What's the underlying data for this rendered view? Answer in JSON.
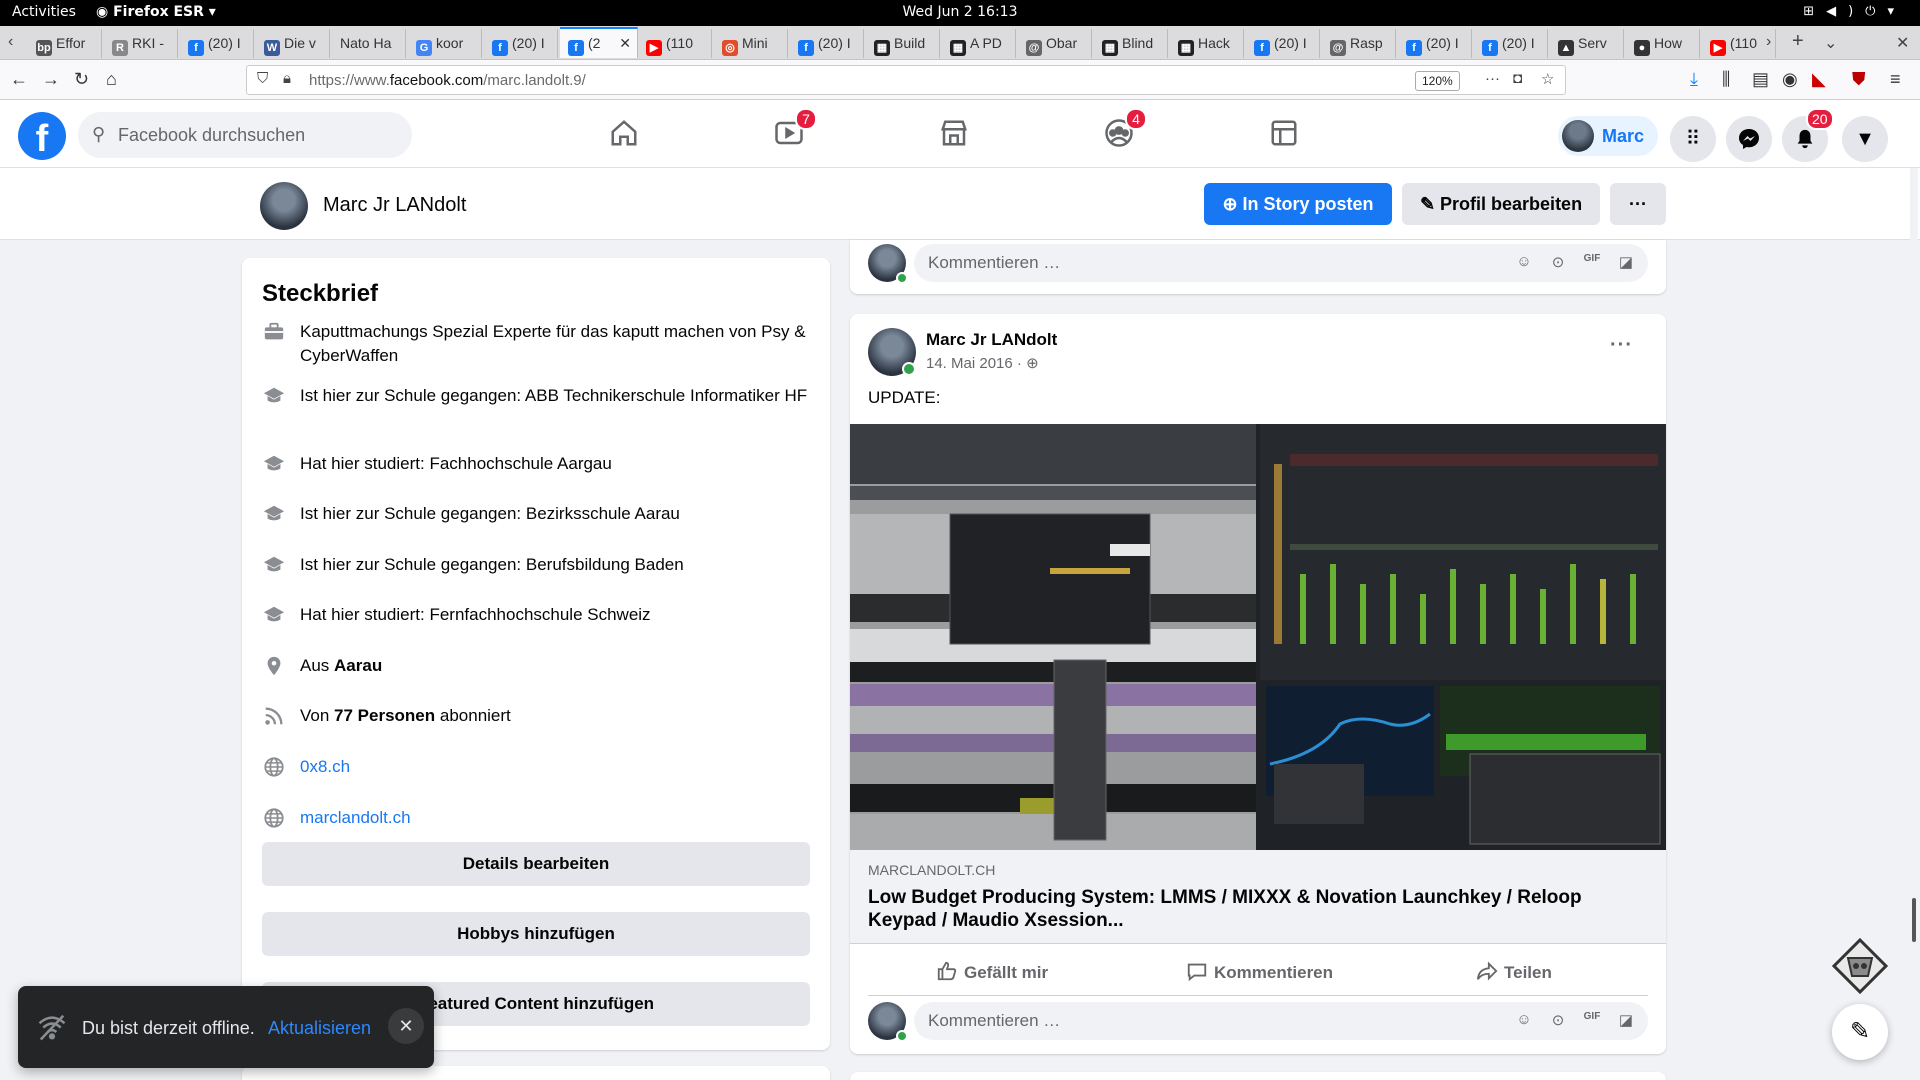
{
  "system": {
    "activities": "Activities",
    "app_name": "Firefox ESR",
    "clock": "Wed Jun 2  16:13"
  },
  "tabs": [
    {
      "label": "Effor",
      "fav": "bp",
      "color": "#555555"
    },
    {
      "label": "RKI -",
      "fav": "R",
      "color": "#888888"
    },
    {
      "label": "(20) I",
      "fav": "f",
      "color": "#1877f2"
    },
    {
      "label": "Die v",
      "fav": "W",
      "color": "#3b5b99"
    },
    {
      "label": "Nato Ha",
      "fav": "",
      "color": "#dcdcdf"
    },
    {
      "label": "koor",
      "fav": "G",
      "color": "#4285f4"
    },
    {
      "label": "(20) I",
      "fav": "f",
      "color": "#1877f2"
    },
    {
      "label": "(2",
      "fav": "f",
      "color": "#1877f2",
      "active": true
    },
    {
      "label": "(110",
      "fav": "▶",
      "color": "#ff0000"
    },
    {
      "label": "Mini",
      "fav": "◎",
      "color": "#e24c2c"
    },
    {
      "label": "(20) I",
      "fav": "f",
      "color": "#1877f2"
    },
    {
      "label": "Build",
      "fav": "▦",
      "color": "#222222"
    },
    {
      "label": "A PD",
      "fav": "▦",
      "color": "#222222"
    },
    {
      "label": "Obar",
      "fav": "@",
      "color": "#666666"
    },
    {
      "label": "Blind",
      "fav": "▦",
      "color": "#222222"
    },
    {
      "label": "Hack",
      "fav": "▦",
      "color": "#222222"
    },
    {
      "label": "(20) I",
      "fav": "f",
      "color": "#1877f2"
    },
    {
      "label": "Rasp",
      "fav": "@",
      "color": "#666666"
    },
    {
      "label": "(20) I",
      "fav": "f",
      "color": "#1877f2"
    },
    {
      "label": "(20) I",
      "fav": "f",
      "color": "#1877f2"
    },
    {
      "label": "Serv",
      "fav": "▲",
      "color": "#333333"
    },
    {
      "label": "How",
      "fav": "●",
      "color": "#333333"
    },
    {
      "label": "(110",
      "fav": "▶",
      "color": "#ff0000"
    }
  ],
  "nav": {
    "url_prefix": "https://www.",
    "url_domain": "facebook.com",
    "url_path": "/marc.landolt.9/",
    "zoom": "120%"
  },
  "fb": {
    "search_placeholder": "Facebook durchsuchen",
    "watch_badge": "7",
    "groups_badge": "4",
    "notif_badge": "20",
    "profile_name": "Marc"
  },
  "profile_bar": {
    "name": "Marc Jr LANdolt",
    "story_button": "In Story posten",
    "edit_button": "Profil bearbeiten",
    "more_button": "···"
  },
  "intro": {
    "title": "Steckbrief",
    "items": [
      {
        "icon": "briefcase-icon",
        "text": "Kaputtmachungs Spezial Experte für das kaputt machen von Psy & CyberWaffen"
      },
      {
        "icon": "graduation-cap-icon",
        "text": "Ist hier zur Schule gegangen: ABB Technikerschule Informatiker HF"
      },
      {
        "icon": "graduation-cap-icon",
        "text": "Hat hier studiert: Fachhochschule Aargau"
      },
      {
        "icon": "graduation-cap-icon",
        "text": "Ist hier zur Schule gegangen: Bezirksschule Aarau"
      },
      {
        "icon": "graduation-cap-icon",
        "text": "Ist hier zur Schule gegangen: Berufsbildung Baden"
      },
      {
        "icon": "graduation-cap-icon",
        "text": "Hat hier studiert: Fernfachhochschule Schweiz"
      }
    ],
    "location_prefix": "Aus ",
    "location": "Aarau",
    "followers_prefix": "Von ",
    "followers": "77 Personen",
    "followers_suffix": " abonniert",
    "website1": "0x8.ch",
    "website2": "marclandolt.ch",
    "btn_details": "Details bearbeiten",
    "btn_hobbies": "Hobbys hinzufügen",
    "btn_featured": "Featured Content hinzufügen"
  },
  "comment_placeholder": "Kommentieren …",
  "post": {
    "author": "Marc Jr LANdolt",
    "date": "14. Mai 2016",
    "text": "UPDATE:",
    "link_domain": "MARCLANDOLT.CH",
    "link_title": "Low Budget Producing System: LMMS / MIXXX & Novation Launchkey / Reloop Keypad / Maudio Xsession...",
    "like": "Gefällt mir",
    "comment": "Kommentieren",
    "share": "Teilen"
  },
  "toast": {
    "message": "Du bist derzeit offline.",
    "action": "Aktualisieren"
  }
}
